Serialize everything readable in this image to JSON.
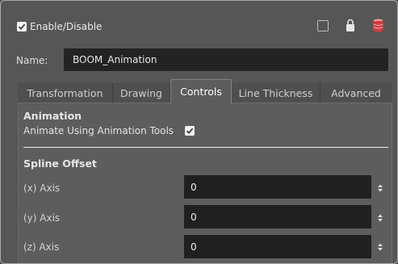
{
  "header": {
    "enable_label": "Enable/Disable",
    "enable_checked": true,
    "icons": [
      "square-icon",
      "lock-icon",
      "database-icon"
    ],
    "accent_color": "#d63c3c"
  },
  "name": {
    "label": "Name:",
    "value": "BOOM_Animation"
  },
  "tabs": [
    {
      "label": "Transformation",
      "active": false
    },
    {
      "label": "Drawing",
      "active": false
    },
    {
      "label": "Controls",
      "active": true
    },
    {
      "label": "Line Thickness",
      "active": false
    },
    {
      "label": "Advanced",
      "active": false
    }
  ],
  "animation": {
    "title": "Animation",
    "option_label": "Animate Using Animation Tools",
    "option_checked": true
  },
  "spline_offset": {
    "title": "Spline Offset",
    "rows": [
      {
        "label": "(x) Axis",
        "value": "0"
      },
      {
        "label": "(y) Axis",
        "value": "0"
      },
      {
        "label": "(z) Axis",
        "value": "0"
      }
    ]
  }
}
